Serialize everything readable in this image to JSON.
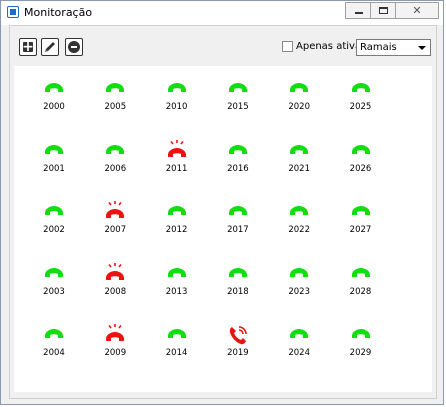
{
  "window": {
    "title": "Monitoração"
  },
  "toolbar": {
    "only_active_label": "Apenas ativas",
    "filter_value": "Ramais"
  },
  "colors": {
    "available": "#11dd11",
    "ringing": "#ee1111",
    "in_call": "#ee1111"
  },
  "extensions": [
    [
      "2000",
      "available"
    ],
    [
      "2005",
      "available"
    ],
    [
      "2010",
      "available"
    ],
    [
      "2015",
      "available"
    ],
    [
      "2020",
      "available"
    ],
    [
      "2025",
      "available"
    ],
    [
      "2001",
      "available"
    ],
    [
      "2006",
      "available"
    ],
    [
      "2011",
      "ringing"
    ],
    [
      "2016",
      "available"
    ],
    [
      "2021",
      "available"
    ],
    [
      "2026",
      "available"
    ],
    [
      "2002",
      "available"
    ],
    [
      "2007",
      "ringing"
    ],
    [
      "2012",
      "available"
    ],
    [
      "2017",
      "available"
    ],
    [
      "2022",
      "available"
    ],
    [
      "2027",
      "available"
    ],
    [
      "2003",
      "available"
    ],
    [
      "2008",
      "ringing"
    ],
    [
      "2013",
      "available"
    ],
    [
      "2018",
      "available"
    ],
    [
      "2023",
      "available"
    ],
    [
      "2028",
      "available"
    ],
    [
      "2004",
      "available"
    ],
    [
      "2009",
      "ringing"
    ],
    [
      "2014",
      "available"
    ],
    [
      "2019",
      "in_call"
    ],
    [
      "2024",
      "available"
    ],
    [
      "2029",
      "available"
    ]
  ]
}
